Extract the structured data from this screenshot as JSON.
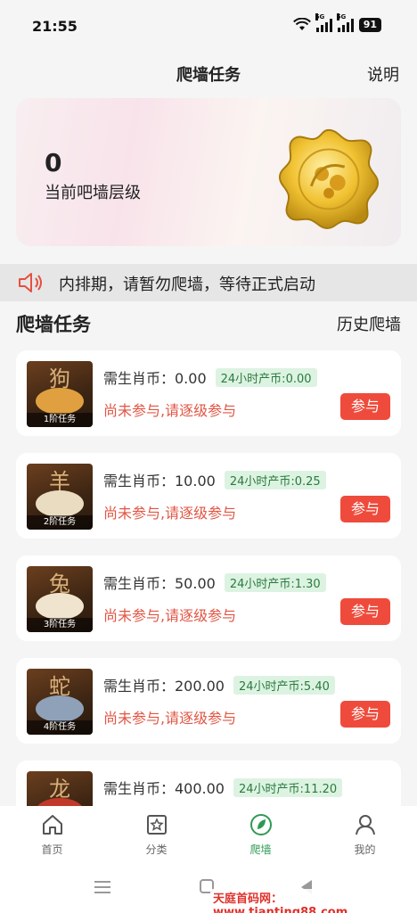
{
  "status_bar": {
    "time": "21:55",
    "battery": "91",
    "signal_label_1": "5G",
    "signal_label_2": "5G"
  },
  "header": {
    "title": "爬墙任务",
    "help_label": "说明"
  },
  "level_card": {
    "value": "0",
    "label": "当前吧墙层级"
  },
  "notice": {
    "text": "内排期，请暂勿爬墙，等待正式启动",
    "icon": "speaker-icon"
  },
  "section": {
    "title": "爬墙任务",
    "history_label": "历史爬墙"
  },
  "tasks": [
    {
      "zodiac": "狗",
      "level": "1阶任务",
      "cost": "需生肖币：0.00",
      "rate": "24小时产币:0.00",
      "status": "尚未参与,请逐级参与",
      "button": "参与",
      "color": "#e0a040"
    },
    {
      "zodiac": "羊",
      "level": "2阶任务",
      "cost": "需生肖币：10.00",
      "rate": "24小时产币:0.25",
      "status": "尚未参与,请逐级参与",
      "button": "参与",
      "color": "#e9dcc0"
    },
    {
      "zodiac": "兔",
      "level": "3阶任务",
      "cost": "需生肖币：50.00",
      "rate": "24小时产币:1.30",
      "status": "尚未参与,请逐级参与",
      "button": "参与",
      "color": "#f1e4cf"
    },
    {
      "zodiac": "蛇",
      "level": "4阶任务",
      "cost": "需生肖币：200.00",
      "rate": "24小时产币:5.40",
      "status": "尚未参与,请逐级参与",
      "button": "参与",
      "color": "#8fa1b8"
    },
    {
      "zodiac": "龙",
      "level": "",
      "cost": "需生肖币：400.00",
      "rate": "24小时产币:11.20",
      "status": "",
      "button": "",
      "color": "#c0392b"
    }
  ],
  "tab_bar": {
    "items": [
      {
        "label": "首页",
        "icon": "home-icon"
      },
      {
        "label": "分类",
        "icon": "category-icon"
      },
      {
        "label": "爬墙",
        "icon": "climb-icon"
      },
      {
        "label": "我的",
        "icon": "profile-icon"
      }
    ],
    "active": "爬墙"
  },
  "watermark": "天庭首码网：www.tianting88.com",
  "colors": {
    "accent_red": "#ef4b3c",
    "accent_green": "#2e9a54",
    "status_red": "#e15645"
  }
}
